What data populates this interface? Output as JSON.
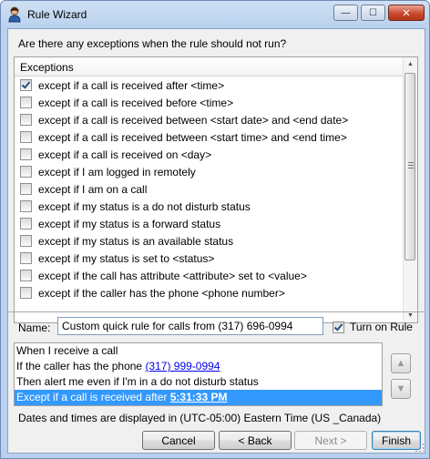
{
  "window": {
    "title": "Rule Wizard",
    "icon": "person-icon",
    "controls": {
      "minimize": "—",
      "maximize": "☐",
      "close": "✕"
    }
  },
  "question": "Are there any exceptions when the rule should not run?",
  "exceptions": {
    "header": "Exceptions",
    "items": [
      {
        "label": "except if a call is received after <time>",
        "checked": true
      },
      {
        "label": "except if a call is received before <time>",
        "checked": false
      },
      {
        "label": "except if a call is received between <start date> and <end date>",
        "checked": false
      },
      {
        "label": "except if a call is received between <start time> and <end time>",
        "checked": false
      },
      {
        "label": "except if a call is received on <day>",
        "checked": false
      },
      {
        "label": "except if I am logged in remotely",
        "checked": false
      },
      {
        "label": "except if I am on a call",
        "checked": false
      },
      {
        "label": "except if my status is a do not disturb status",
        "checked": false
      },
      {
        "label": "except if my status is a forward status",
        "checked": false
      },
      {
        "label": "except if my status is an available status",
        "checked": false
      },
      {
        "label": "except if my status is set to <status>",
        "checked": false
      },
      {
        "label": "except if the call has attribute <attribute> set to <value>",
        "checked": false
      },
      {
        "label": "except if the caller has the phone <phone number>",
        "checked": false
      }
    ]
  },
  "name": {
    "label": "Name:",
    "value": "Custom quick rule for calls from (317) 696-0994"
  },
  "turn_on_rule": {
    "label": "Turn on Rule",
    "checked": true
  },
  "description": {
    "line1": "When I receive a call",
    "line2_prefix": "If the caller has the phone ",
    "line2_link": "(317) 999-0994",
    "line3": "Then alert me even if I'm in a do not disturb status",
    "line4_prefix": "Except if a call is received after ",
    "line4_link": "5:31:33 PM"
  },
  "move": {
    "up_icon": "arrow-up-icon",
    "down_icon": "arrow-down-icon",
    "up": "▲",
    "down": "▼"
  },
  "timezone_note": "Dates and times are displayed in (UTC-05:00) Eastern Time (US _Canada)",
  "buttons": {
    "cancel": "Cancel",
    "back": "< Back",
    "next": "Next >",
    "finish": "Finish"
  }
}
